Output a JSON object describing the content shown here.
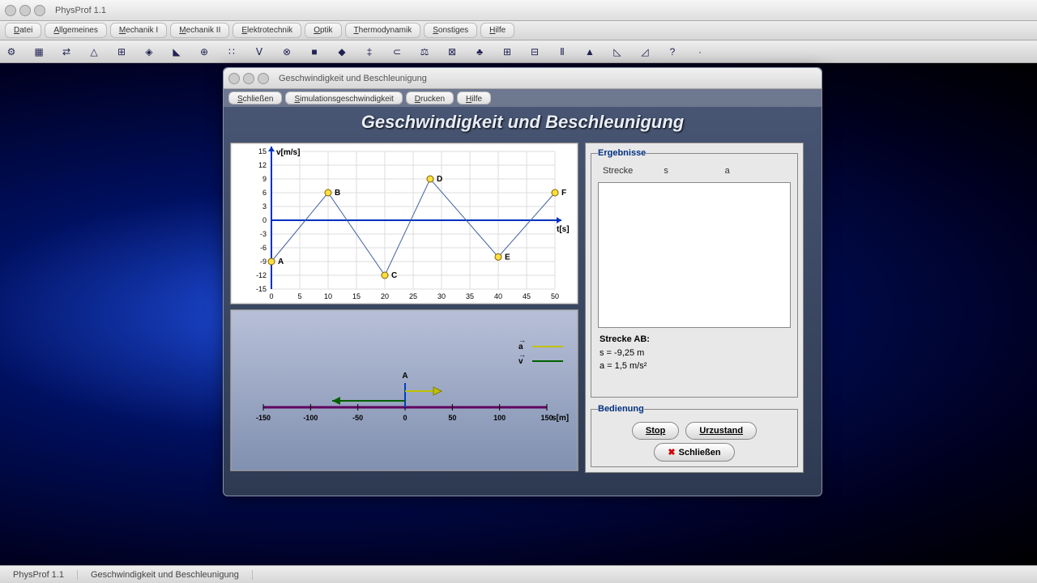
{
  "app_title": "PhysProf 1.1",
  "main_menu": [
    "Datei",
    "Allgemeines",
    "Mechanik I",
    "Mechanik II",
    "Elektrotechnik",
    "Optik",
    "Thermodynamik",
    "Sonstiges",
    "Hilfe"
  ],
  "toolbar_icon_count": 26,
  "statusbar": {
    "app": "PhysProf 1.1",
    "doc": "Geschwindigkeit und Beschleunigung"
  },
  "subwindow": {
    "title": "Geschwindigkeit und Beschleunigung",
    "menu": [
      "Schließen",
      "Simulationsgeschwindigkeit",
      "Drucken",
      "Hilfe"
    ],
    "banner": "Geschwindigkeit und Beschleunigung"
  },
  "results": {
    "group_title": "Ergebnisse",
    "cols": [
      "Strecke",
      "s",
      "a"
    ],
    "summary_label": "Strecke AB:",
    "s_line": "s  =  -9,25 m",
    "a_line": "a  =  1,5 m/s²"
  },
  "controls": {
    "group_title": "Bedienung",
    "stop": "Stop",
    "reset": "Urzustand",
    "close": "Schließen"
  },
  "chart_data": {
    "type": "line",
    "title": "",
    "xlabel": "t[s]",
    "ylabel": "v[m/s]",
    "xlim": [
      0,
      50
    ],
    "ylim": [
      -15,
      15
    ],
    "xticks": [
      0,
      5,
      10,
      15,
      20,
      25,
      30,
      35,
      40,
      45,
      50
    ],
    "yticks": [
      -15,
      -12,
      -9,
      -6,
      -3,
      0,
      3,
      6,
      9,
      12,
      15
    ],
    "points": [
      {
        "label": "A",
        "t": 0,
        "v": -9
      },
      {
        "label": "B",
        "t": 10,
        "v": 6
      },
      {
        "label": "C",
        "t": 20,
        "v": -12
      },
      {
        "label": "D",
        "t": 28,
        "v": 9
      },
      {
        "label": "E",
        "t": 40,
        "v": -8
      },
      {
        "label": "F",
        "t": 50,
        "v": 6
      }
    ]
  },
  "sim_axis": {
    "label": "s[m]",
    "ticks": [
      -150,
      -100,
      -50,
      0,
      50,
      100,
      150
    ],
    "marker_label": "A",
    "legend_a": "a",
    "legend_v": "v"
  }
}
